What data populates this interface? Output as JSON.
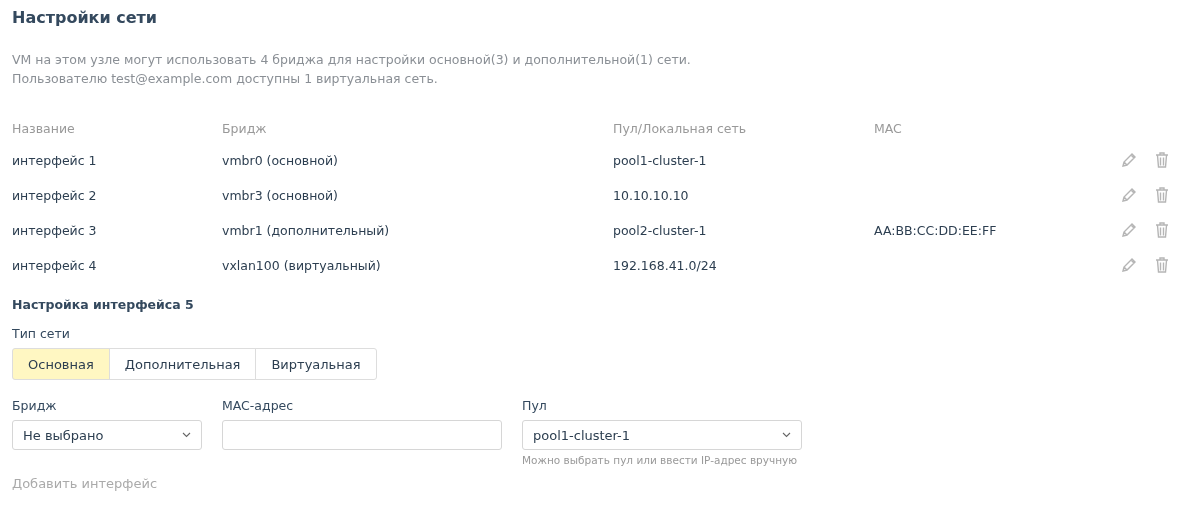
{
  "title": "Настройки сети",
  "description": [
    "VM на этом узле могут использовать 4 бриджа для настройки основной(3) и дополнительной(1) сети.",
    "Пользователю test@example.com доступны 1 виртуальная сеть."
  ],
  "table": {
    "columns": [
      "Название",
      "Бридж",
      "Пул/Локальная сеть",
      "MAC"
    ],
    "rows": [
      {
        "name": "интерфейс 1",
        "bridge": "vmbr0  (основной)",
        "pool": "pool1-cluster-1"
      },
      {
        "name": "интерфейс 2",
        "bridge": "vmbr3  (основной)",
        "pool": "10.10.10.10"
      },
      {
        "name": "интерфейс 3",
        "bridge": "vmbr1  (дополнительный)",
        "pool": "pool2-cluster-1",
        "mac": "AA:BB:CC:DD:EE:FF"
      },
      {
        "name": "интерфейс 4",
        "bridge": "vxlan100  (виртуальный)",
        "pool": "192.168.41.0/24"
      }
    ]
  },
  "form": {
    "title": "Настройка интерфейса 5",
    "network_type_label": "Тип сети",
    "network_types": [
      {
        "label": "Основная",
        "selected": true
      },
      {
        "label": "Дополнительная",
        "selected": false
      },
      {
        "label": "Виртуальная",
        "selected": false
      }
    ],
    "bridge": {
      "label": "Бридж",
      "value": "Не выбрано"
    },
    "mac": {
      "label": "MAC-адрес"
    },
    "pool": {
      "label": "Пул",
      "value": "pool1-cluster-1",
      "hint": "Можно выбрать пул или ввести IP-адрес вручную"
    },
    "add_button": {
      "label": "Добавить интерфейс",
      "disabled": true
    }
  }
}
